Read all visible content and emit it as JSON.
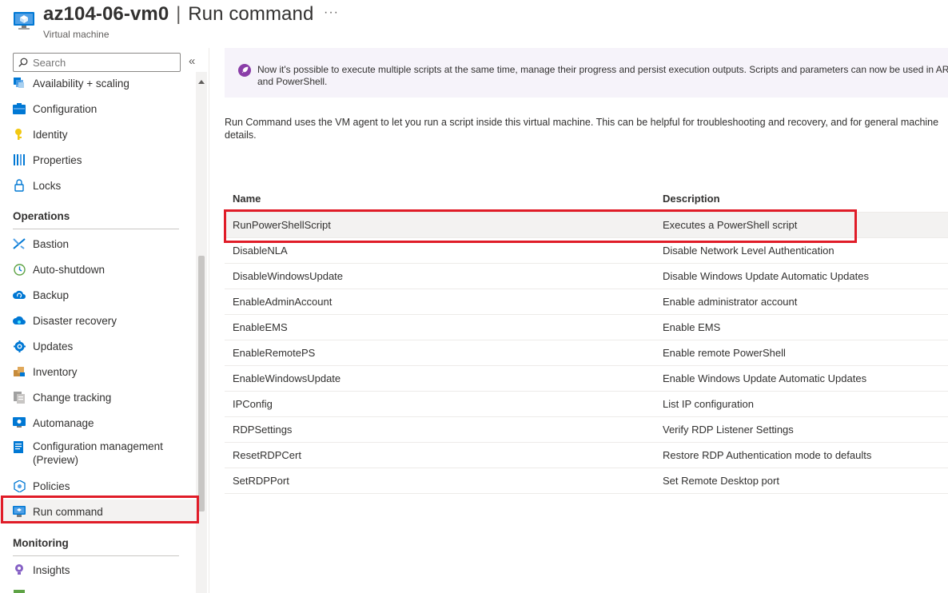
{
  "header": {
    "resource_name": "az104-06-vm0",
    "separator": "|",
    "page_title": "Run command",
    "subtitle": "Virtual machine",
    "more_label": "···"
  },
  "sidebar": {
    "search_placeholder": "Search",
    "collapse_label": "«",
    "items_top": [
      {
        "label": "Availability + scaling",
        "icon": "availability-icon"
      },
      {
        "label": "Configuration",
        "icon": "configuration-icon"
      },
      {
        "label": "Identity",
        "icon": "identity-icon"
      },
      {
        "label": "Properties",
        "icon": "properties-icon"
      },
      {
        "label": "Locks",
        "icon": "lock-icon"
      }
    ],
    "operations_heading": "Operations",
    "operations": [
      {
        "label": "Bastion",
        "icon": "bastion-icon"
      },
      {
        "label": "Auto-shutdown",
        "icon": "clock-icon"
      },
      {
        "label": "Backup",
        "icon": "backup-icon"
      },
      {
        "label": "Disaster recovery",
        "icon": "disaster-recovery-icon"
      },
      {
        "label": "Updates",
        "icon": "updates-icon"
      },
      {
        "label": "Inventory",
        "icon": "inventory-icon"
      },
      {
        "label": "Change tracking",
        "icon": "change-tracking-icon"
      },
      {
        "label": "Automanage",
        "icon": "automanage-icon"
      },
      {
        "label": "Configuration management",
        "label2": "(Preview)",
        "icon": "configuration-management-icon"
      },
      {
        "label": "Policies",
        "icon": "policies-icon"
      },
      {
        "label": "Run command",
        "icon": "run-command-icon"
      }
    ],
    "monitoring_heading": "Monitoring",
    "monitoring": [
      {
        "label": "Insights",
        "icon": "insights-icon"
      }
    ]
  },
  "main": {
    "banner": {
      "line1": "Now it's possible to execute multiple scripts at the same time, manage their progress and persist execution outputs. Scripts and parameters can now be used in ARM",
      "line2": "and PowerShell.",
      "icon": "rocket-icon"
    },
    "description_line1": "Run Command uses the VM agent to let you run a script inside this virtual machine. This can be helpful for troubleshooting and recovery, and for general machine",
    "description_line2": "details.",
    "table": {
      "columns": [
        "Name",
        "Description"
      ],
      "rows": [
        {
          "name": "RunPowerShellScript",
          "description": "Executes a PowerShell script"
        },
        {
          "name": "DisableNLA",
          "description": "Disable Network Level Authentication"
        },
        {
          "name": "DisableWindowsUpdate",
          "description": "Disable Windows Update Automatic Updates"
        },
        {
          "name": "EnableAdminAccount",
          "description": "Enable administrator account"
        },
        {
          "name": "EnableEMS",
          "description": "Enable EMS"
        },
        {
          "name": "EnableRemotePS",
          "description": "Enable remote PowerShell"
        },
        {
          "name": "EnableWindowsUpdate",
          "description": "Enable Windows Update Automatic Updates"
        },
        {
          "name": "IPConfig",
          "description": "List IP configuration"
        },
        {
          "name": "RDPSettings",
          "description": "Verify RDP Listener Settings"
        },
        {
          "name": "ResetRDPCert",
          "description": "Restore RDP Authentication mode to defaults"
        },
        {
          "name": "SetRDPPort",
          "description": "Set Remote Desktop port"
        }
      ]
    }
  },
  "colors": {
    "highlight": "#e01c28",
    "azure_blue": "#0078d4",
    "banner_bg": "#f6f3fa"
  }
}
